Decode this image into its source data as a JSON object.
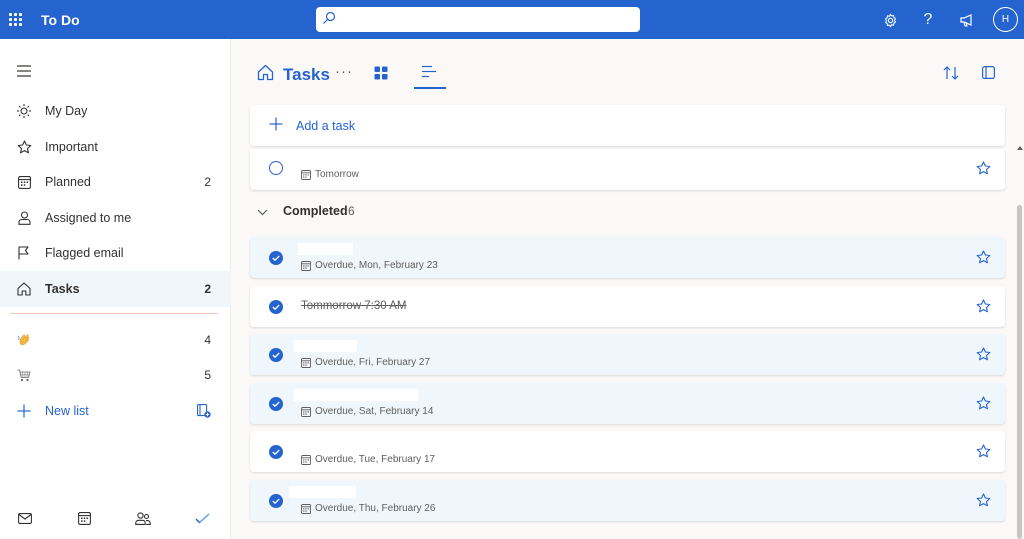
{
  "app": {
    "title": "To Do"
  },
  "search": {
    "value": "",
    "placeholder": ""
  },
  "header": {
    "avatar_initial": "H"
  },
  "sidebar": {
    "items": [
      {
        "label": "My Day",
        "count": "",
        "icon": "sun-icon"
      },
      {
        "label": "Important",
        "count": "",
        "icon": "star-icon"
      },
      {
        "label": "Planned",
        "count": "2",
        "icon": "calendar-icon"
      },
      {
        "label": "Assigned to me",
        "count": "",
        "icon": "person-icon"
      },
      {
        "label": "Flagged email",
        "count": "",
        "icon": "flag-icon"
      },
      {
        "label": "Tasks",
        "count": "2",
        "icon": "home-icon"
      }
    ],
    "lists": [
      {
        "label": "",
        "count": "4",
        "icon": "waving-hand-emoji"
      },
      {
        "label": "",
        "count": "5",
        "icon": "shopping-cart-emoji"
      }
    ],
    "new_list_label": "New list"
  },
  "main": {
    "title": "Tasks",
    "more": "···",
    "add_task_label": "Add a task",
    "open_task": {
      "title": "",
      "due": "Tomorrow"
    },
    "completed": {
      "label": "Completed",
      "count": "6"
    },
    "completed_tasks": [
      {
        "title": "",
        "due": "Overdue, Mon, February 23"
      },
      {
        "title": "Tommorrow 7:30 AM",
        "due": ""
      },
      {
        "title": "",
        "due": "Overdue, Fri, February 27"
      },
      {
        "title": "",
        "due": "Overdue, Sat, February 14"
      },
      {
        "title": "",
        "due": "Overdue, Tue, February 17"
      },
      {
        "title": "",
        "due": "Overdue, Thu, February 26"
      }
    ]
  },
  "colors": {
    "accent": "#2564cf",
    "highlight": "#eff6fc",
    "background": "#faf9f8"
  }
}
